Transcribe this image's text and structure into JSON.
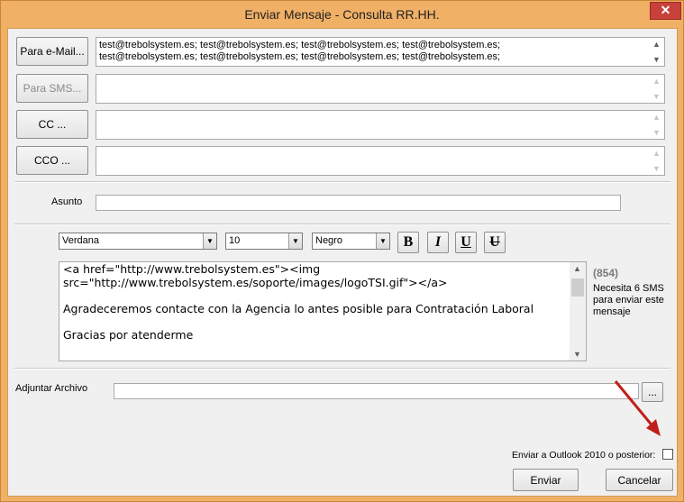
{
  "window": {
    "title": "Enviar Mensaje - Consulta RR.HH.",
    "close_glyph": "✕"
  },
  "recipients": {
    "email_button": "Para e-Mail...",
    "email_lines": [
      "test@trebolsystem.es; test@trebolsystem.es; test@trebolsystem.es; test@trebolsystem.es;",
      "test@trebolsystem.es; test@trebolsystem.es; test@trebolsystem.es; test@trebolsystem.es;"
    ],
    "sms_button": "Para SMS...",
    "sms_value": "",
    "cc_button": "CC ...",
    "cc_value": "",
    "bcc_button": "CCO ...",
    "bcc_value": ""
  },
  "subject": {
    "label": "Asunto",
    "value": ""
  },
  "format": {
    "font": "Verdana",
    "size": "10",
    "color": "Negro",
    "bold": "B",
    "italic": "I",
    "underline": "U",
    "strike": "U"
  },
  "message": {
    "lines": [
      "<a href=\"http://www.trebolsystem.es\"><img",
      "src=\"http://www.trebolsystem.es/soporte/images/logoTSI.gif\"></a>",
      "",
      "Agradeceremos contacte con la Agencia lo antes posible para Contratación Laboral",
      "",
      "Gracias por atenderme"
    ]
  },
  "sms_info": {
    "count": "(854)",
    "note": "Necesita 6 SMS para enviar este mensaje"
  },
  "attachment": {
    "label": "Adjuntar Archivo",
    "value": "",
    "browse_label": "..."
  },
  "outlook": {
    "label": "Enviar a Outlook 2010 o posterior:",
    "checked": false
  },
  "actions": {
    "send": "Enviar",
    "cancel": "Cancelar"
  },
  "icons": {
    "dropdown": "chevron-down-icon",
    "scroll_up": "scroll-up-icon",
    "scroll_down": "scroll-down-icon",
    "arrow": "red-arrow-icon"
  },
  "colors": {
    "frame": "#f0b066",
    "close": "#c7413a",
    "arrow": "#c0201c",
    "sms_count": "#7a7a7a"
  }
}
